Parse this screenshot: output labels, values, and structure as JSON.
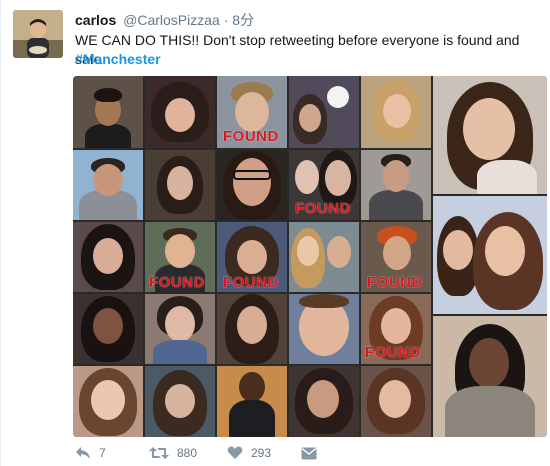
{
  "tweet": {
    "name": "carlos",
    "handle": "@CarlosPizzaa",
    "separator": "·",
    "time": "8分",
    "text": "WE CAN DO THIS!! Don't stop retweeting before everyone is found and safe",
    "hashtag": "#Manchester"
  },
  "media": {
    "found_label": "FOUND"
  },
  "actions": {
    "reply_count": "7",
    "retweet_count": "880",
    "like_count": "293"
  },
  "colors": {
    "hashtag": "#1b95e0",
    "found_text": "#d8181e",
    "muted": "#657786"
  },
  "icons": [
    "reply-icon",
    "retweet-icon",
    "heart-icon",
    "message-icon"
  ]
}
